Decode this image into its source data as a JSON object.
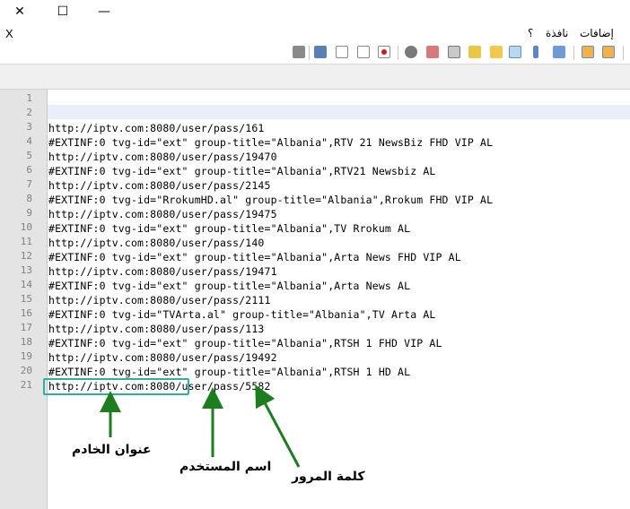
{
  "window": {
    "close_glyph": "✕",
    "maximize_glyph": "☐",
    "minimize_glyph": "—"
  },
  "menubar": {
    "close_doc": "X",
    "items": [
      "إضافات",
      "نافذة",
      "؟"
    ]
  },
  "toolbar": {
    "icons": [
      "macro-playback-icon",
      "rewind-icon",
      "prev-icon",
      "stop-record-icon",
      "record-icon",
      "speech-bubble-icon",
      "folder-icon",
      "monitor-icon",
      "notepad-icon",
      "view-icon",
      "wrap-icon",
      "indent-icon",
      "columns-icon",
      "panel-icon",
      "split-icon"
    ]
  },
  "editor": {
    "line_numbers": [
      "1",
      "2",
      "3",
      "4",
      "5",
      "6",
      "7",
      "8",
      "9",
      "10",
      "11",
      "12",
      "13",
      "14",
      "15",
      "16",
      "17",
      "18",
      "19",
      "20",
      "21"
    ],
    "lines": [
      "",
      "",
      "http://iptv.com:8080/user/pass/161",
      "#EXTINF:0 tvg-id=\"ext\" group-title=\"Albania\",RTV 21 NewsBiz FHD VIP AL",
      "http://iptv.com:8080/user/pass/19470",
      "#EXTINF:0 tvg-id=\"ext\" group-title=\"Albania\",RTV21 Newsbiz AL",
      "http://iptv.com:8080/user/pass/2145",
      "#EXTINF:0 tvg-id=\"RrokumHD.al\" group-title=\"Albania\",Rrokum FHD VIP AL",
      "http://iptv.com:8080/user/pass/19475",
      "#EXTINF:0 tvg-id=\"ext\" group-title=\"Albania\",TV Rrokum AL",
      "http://iptv.com:8080/user/pass/140",
      "#EXTINF:0 tvg-id=\"ext\" group-title=\"Albania\",Arta News FHD VIP AL",
      "http://iptv.com:8080/user/pass/19471",
      "#EXTINF:0 tvg-id=\"ext\" group-title=\"Albania\",Arta News AL",
      "http://iptv.com:8080/user/pass/2111",
      "#EXTINF:0 tvg-id=\"TVArta.al\" group-title=\"Albania\",TV Arta AL",
      "http://iptv.com:8080/user/pass/113",
      "#EXTINF:0 tvg-id=\"ext\" group-title=\"Albania\",RTSH 1 FHD VIP AL",
      "http://iptv.com:8080/user/pass/19492",
      "#EXTINF:0 tvg-id=\"ext\" group-title=\"Albania\",RTSH 1 HD AL",
      "http://iptv.com:8080/user/pass/5582"
    ]
  },
  "annotations": {
    "server": "عنوان الخادم",
    "username": "اسم المستخدم",
    "password": "كلمة المرور",
    "color": "#1e7d1e",
    "box_color": "#2eb09a"
  }
}
